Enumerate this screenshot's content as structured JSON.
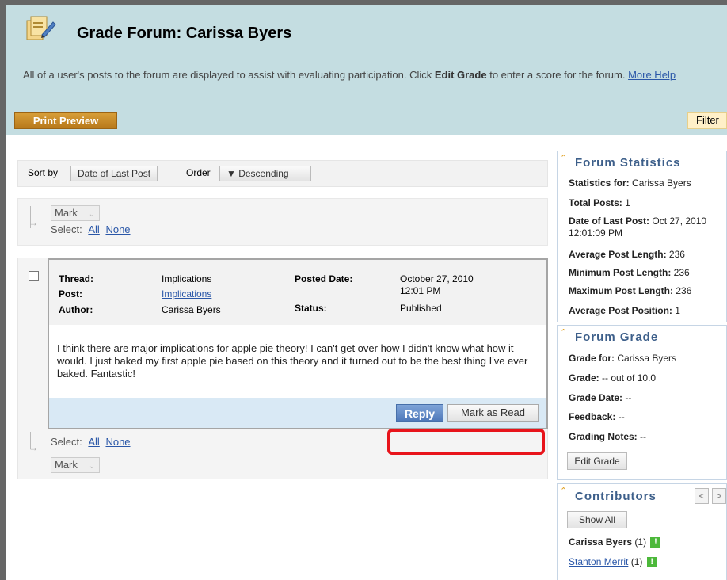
{
  "header": {
    "title": "Grade Forum: Carissa Byers",
    "description_pre": "All of a user's posts to the forum are displayed to assist with evaluating participation. Click ",
    "description_bold": "Edit Grade",
    "description_post": " to enter a score for the forum. ",
    "more_help": "More Help",
    "print_preview": "Print Preview",
    "filter": "Filter"
  },
  "sort": {
    "sort_by_label": "Sort by",
    "sort_by_value": "Date of Last Post",
    "order_label": "Order",
    "order_value": "▼ Descending"
  },
  "mark_bar": {
    "mark_label": "Mark",
    "select_label": "Select:",
    "all": "All",
    "none": "None"
  },
  "post": {
    "thread_label": "Thread:",
    "thread_value": "Implications",
    "post_label": "Post:",
    "post_value": "Implications",
    "author_label": "Author:",
    "author_value": "Carissa Byers",
    "posted_date_label": "Posted Date:",
    "posted_date_value": "October 27, 2010",
    "posted_time_value": "12:01 PM",
    "status_label": "Status:",
    "status_value": "Published",
    "body": "I think there are major implications for apple pie theory!   I can't get over how I didn't know what how it would.  I just baked my first apple pie based on this theory and it turned out to be the best thing I've ever baked.  Fantastic!",
    "reply": "Reply",
    "mark_as_read": "Mark as Read"
  },
  "stats": {
    "title": "Forum Statistics",
    "stats_for_label": "Statistics for:",
    "stats_for_value": "Carissa Byers",
    "total_posts_label": "Total Posts:",
    "total_posts_value": "1",
    "last_post_label": "Date of Last Post:",
    "last_post_value": "Oct 27, 2010",
    "last_post_time": "12:01:09 PM",
    "avg_len_label": "Average Post Length:",
    "avg_len_value": "236",
    "min_len_label": "Minimum Post Length:",
    "min_len_value": "236",
    "max_len_label": "Maximum Post Length:",
    "max_len_value": "236",
    "avg_pos_label": "Average Post Position:",
    "avg_pos_value": "1"
  },
  "grade": {
    "title": "Forum Grade",
    "grade_for_label": "Grade for:",
    "grade_for_value": "Carissa Byers",
    "grade_label": "Grade:",
    "grade_value": "-- out of 10.0",
    "grade_date_label": "Grade Date:",
    "grade_date_value": "--",
    "feedback_label": "Feedback:",
    "feedback_value": "--",
    "notes_label": "Grading Notes:",
    "notes_value": "--",
    "edit_grade": "Edit Grade"
  },
  "contributors": {
    "title": "Contributors",
    "show_all": "Show All",
    "prev": "<",
    "next": ">",
    "items": [
      {
        "name": "Carissa Byers",
        "count": "(1)"
      },
      {
        "name": "Stanton Merrit",
        "count": "(1)"
      }
    ],
    "badge": "!"
  },
  "colors": {
    "header_bg": "#c4dde1",
    "accent_orange": "#c98a2a",
    "reply_blue": "#4f79ba",
    "highlight_red": "#e8141b",
    "badge_green": "#4cb83a"
  }
}
